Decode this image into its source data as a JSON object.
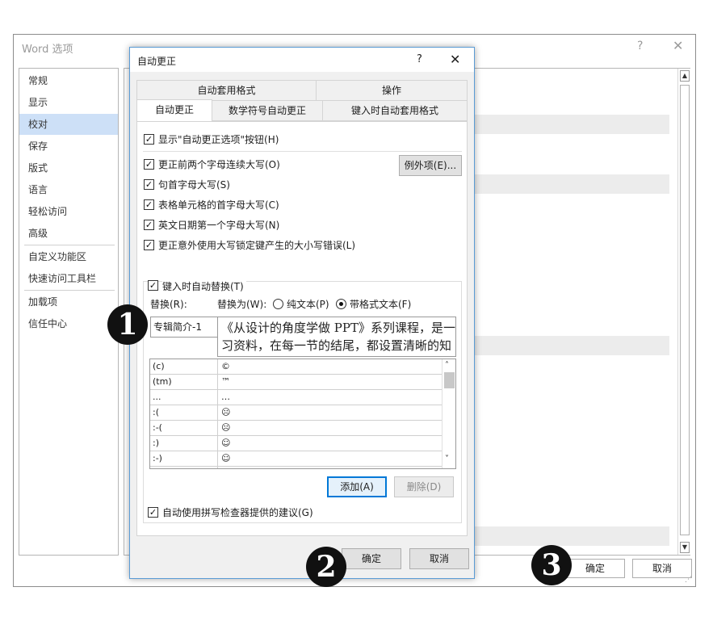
{
  "outer_window": {
    "title": "Word 选项",
    "help_glyph": "?",
    "close_glyph": "✕",
    "sidebar_items": [
      {
        "label": "常规"
      },
      {
        "label": "显示"
      },
      {
        "label": "校对",
        "selected": true
      },
      {
        "label": "保存"
      },
      {
        "label": "版式"
      },
      {
        "label": "语言"
      },
      {
        "label": "轻松访问"
      },
      {
        "label": "高级"
      },
      {
        "label": "自定义功能区"
      },
      {
        "label": "快速访问工具栏"
      },
      {
        "label": "加载项"
      },
      {
        "label": "信任中心"
      }
    ],
    "ok_label": "确定",
    "cancel_label": "取消"
  },
  "dialog": {
    "title": "自动更正",
    "help_glyph": "?",
    "close_glyph": "✕",
    "tabs_back": [
      "自动套用格式",
      "操作"
    ],
    "tabs_front": [
      "自动更正",
      "数学符号自动更正",
      "键入时自动套用格式"
    ],
    "active_tab": "自动更正",
    "show_buttons_option": "显示\"自动更正选项\"按钮(H)",
    "exceptions_button": "例外项(E)...",
    "options": [
      "更正前两个字母连续大写(O)",
      "句首字母大写(S)",
      "表格单元格的首字母大写(C)",
      "英文日期第一个字母大写(N)",
      "更正意外使用大写锁定键产生的大小写错误(L)"
    ],
    "replace_while_typing": "键入时自动替换(T)",
    "replace_label": "替换(R):",
    "with_label": "替换为(W):",
    "plain_text": "纯文本(P)",
    "formatted_text": "带格式文本(F)",
    "replace_value": "专辑简介-1",
    "with_value_line1": "《从设计的角度学做 PPT》系列课程，是一",
    "with_value_line2": "习资料，在每一节的结尾，都设置清晰的知",
    "entries": [
      {
        "from": "(c)",
        "to": "©"
      },
      {
        "from": "(tm)",
        "to": "™"
      },
      {
        "from": "...",
        "to": "…"
      },
      {
        "from": ":(",
        "to": "☹"
      },
      {
        "from": ":-(",
        "to": "☹"
      },
      {
        "from": ":)",
        "to": "☺"
      },
      {
        "from": ":-)",
        "to": "☺"
      }
    ],
    "add_button": "添加(A)",
    "delete_button": "删除(D)",
    "spellcheck_option": "自动使用拼写检查器提供的建议(G)",
    "ok_label": "确定",
    "cancel_label": "取消"
  },
  "markers": [
    "1",
    "2",
    "3"
  ],
  "colors": {
    "accent": "#0078d7",
    "selected_sidebar": "#cde0f7",
    "dialog_border": "#5a9bd5"
  }
}
